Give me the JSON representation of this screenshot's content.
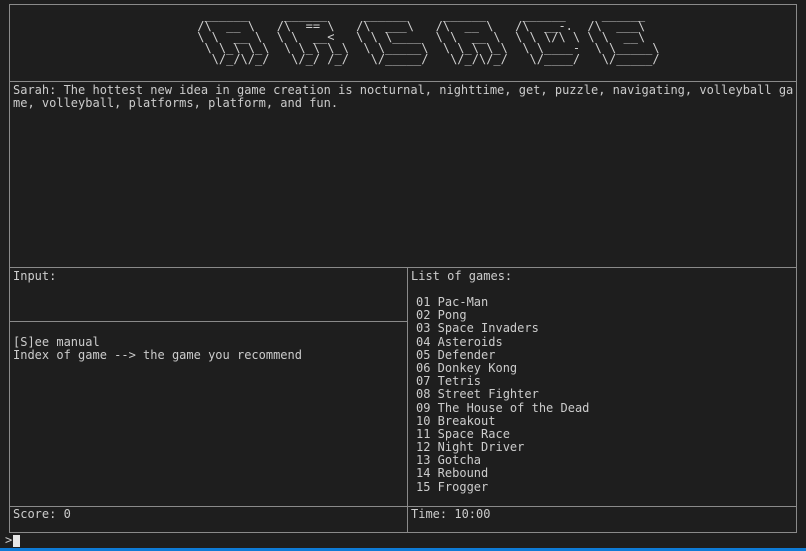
{
  "logo": {
    "alt": "ARCADE",
    "ascii": [
      "  ______     ______     ______     ______     ______     ______ ",
      " /\\  __ \\   /\\  == \\   /\\  ___\\   /\\  __ \\   /\\  __-.  /\\  ___\\ ",
      " \\ \\  __ \\  \\ \\  __<   \\ \\ \\____  \\ \\  __ \\  \\ \\ \\/\\ \\ \\ \\  __\\ ",
      "  \\ \\_\\ \\_\\  \\ \\_\\ \\_\\  \\ \\_____\\  \\ \\_\\ \\_\\  \\ \\____-  \\ \\_____\\",
      "   \\/_/\\/_/   \\/_/ /_/   \\/_____/   \\/_/\\/_/   \\/____/   \\/_____/"
    ]
  },
  "dialog": {
    "speaker": "Sarah",
    "message": "The hottest new idea in game creation is nocturnal, nighttime, get, puzzle, navigating, volleyball game, volleyball, platforms, platform, and fun."
  },
  "input_panel": {
    "title": "Input:",
    "current_value": ""
  },
  "help": {
    "manual": "[S]ee manual",
    "instruction": "Index of game --> the game you recommend"
  },
  "games_panel": {
    "title": "List of games:",
    "items": [
      "01 Pac-Man",
      "02 Pong",
      "03 Space Invaders",
      "04 Asteroids",
      "05 Defender",
      "06 Donkey Kong",
      "07 Tetris",
      "08 Street Fighter",
      "09 The House of the Dead",
      "10 Breakout",
      "11 Space Race",
      "12 Night Driver",
      "13 Gotcha",
      "14 Rebound",
      "15 Frogger"
    ]
  },
  "score": {
    "text": "Score: 0"
  },
  "timer": {
    "text": "Time: 10:00"
  },
  "prompt": {
    "symbol": ">"
  },
  "colors": {
    "background": "#1e1e1e",
    "text": "#cccccc",
    "border": "#8a8a8a",
    "status_bar": "#0e7bd6"
  }
}
